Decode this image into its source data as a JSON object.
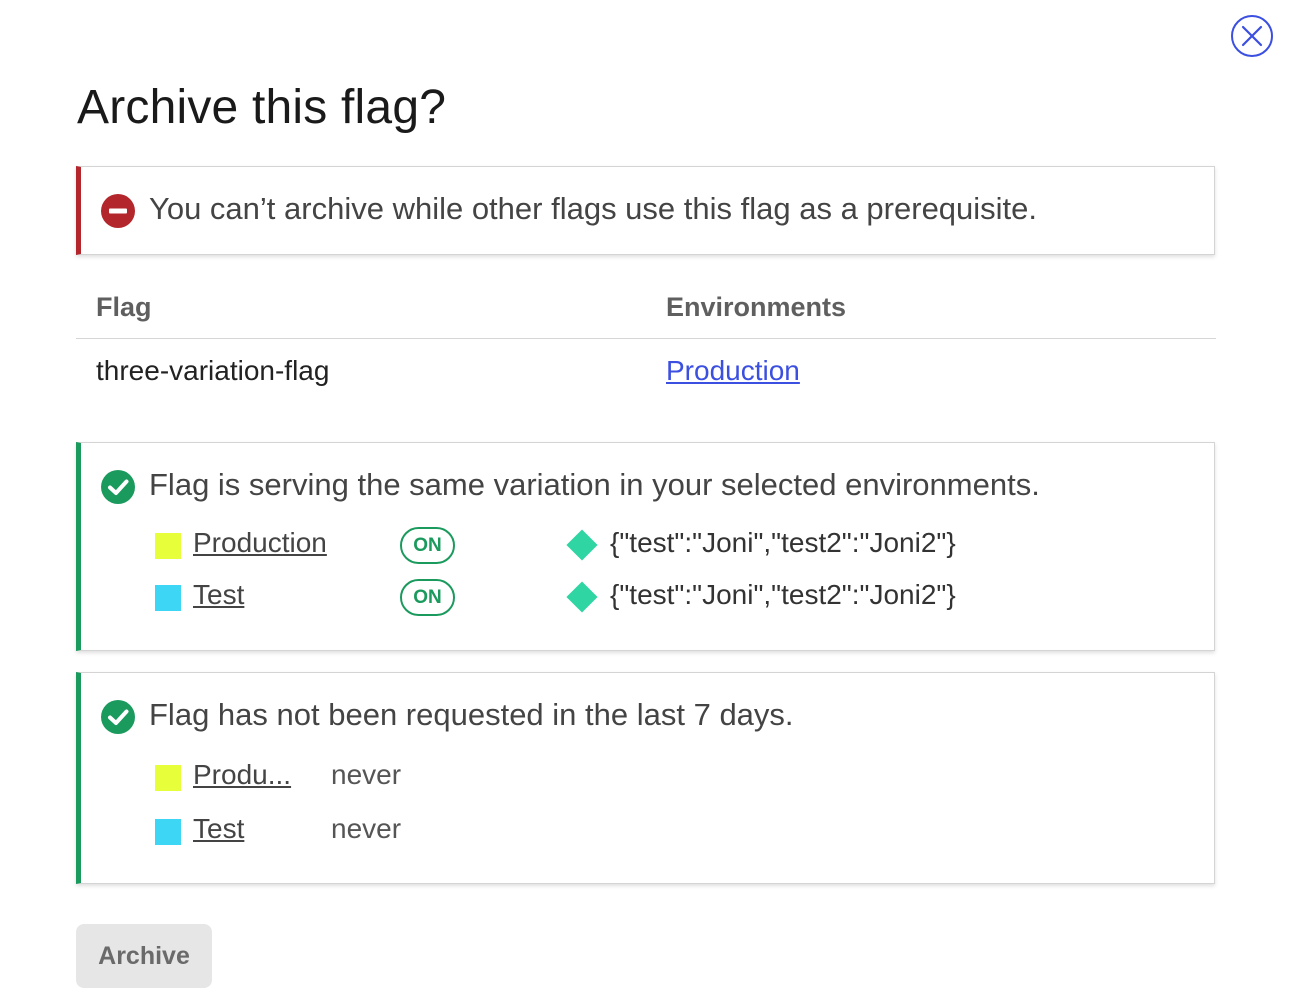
{
  "dialog": {
    "title": "Archive this flag?",
    "close_icon": "close-circle-icon"
  },
  "error_callout": {
    "icon": "error-minus-icon",
    "message": "You can’t archive while other flags use this flag as a prerequisite."
  },
  "prereq_table": {
    "headers": [
      "Flag",
      "Environments"
    ],
    "rows": [
      {
        "flag": "three-variation-flag",
        "environment": "Production"
      }
    ]
  },
  "variation_callout": {
    "icon": "check-circle-icon",
    "message": "Flag is serving the same variation in your selected environments.",
    "rows": [
      {
        "env": "Production",
        "color": "#e6ff3a",
        "status": "ON",
        "variation": "{\"test\":\"Joni\",\"test2\":\"Joni2\"}"
      },
      {
        "env": "Test",
        "color": "#3dd6f5",
        "status": "ON",
        "variation": "{\"test\":\"Joni\",\"test2\":\"Joni2\"}"
      }
    ]
  },
  "requests_callout": {
    "icon": "check-circle-icon",
    "message": "Flag has not been requested in the last 7 days.",
    "rows": [
      {
        "env": "Produ...",
        "color": "#e6ff3a",
        "last_requested": "never"
      },
      {
        "env": "Test",
        "color": "#3dd6f5",
        "last_requested": "never"
      }
    ]
  },
  "footer": {
    "archive_label": "Archive"
  },
  "colors": {
    "error": "#b3262b",
    "success": "#1b9a5e",
    "link": "#3b4fe0",
    "variation_diamond": "#2fd5a2"
  }
}
